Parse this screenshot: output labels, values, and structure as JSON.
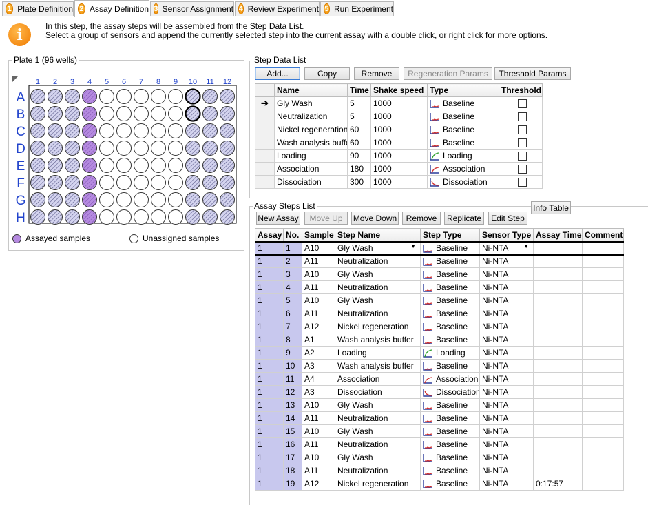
{
  "tabs": [
    {
      "num": "1",
      "label": "Plate Definition"
    },
    {
      "num": "2",
      "label": "Assay Definition"
    },
    {
      "num": "3",
      "label": "Sensor Assignment"
    },
    {
      "num": "4",
      "label": "Review Experiment"
    },
    {
      "num": "5",
      "label": "Run Experiment"
    }
  ],
  "info": {
    "icon": "i",
    "line1": "In this step, the assay steps will be assembled from the Step Data List.",
    "line2": "Select a group of sensors and append the currently selected step into the current assay with a double click, or right click for more options."
  },
  "plate": {
    "title": "Plate 1 (96 wells)",
    "cols": [
      "1",
      "2",
      "3",
      "4",
      "5",
      "6",
      "7",
      "8",
      "9",
      "10",
      "11",
      "12"
    ],
    "rows": [
      "A",
      "B",
      "C",
      "D",
      "E",
      "F",
      "G",
      "H"
    ],
    "legend_assayed": "Assayed samples",
    "legend_unassigned": "Unassigned samples",
    "colors": {
      "sensor": "#d4d4ef",
      "assayed": "#b58ae0",
      "empty": "#ffffff",
      "label": "#2244cc"
    },
    "well_types_note": "s=sensor hatched, a=assayed, e=empty, x=sensor selected",
    "wells": [
      [
        "s",
        "s",
        "s",
        "a",
        "e",
        "e",
        "e",
        "e",
        "e",
        "x",
        "s",
        "s"
      ],
      [
        "s",
        "s",
        "s",
        "a",
        "e",
        "e",
        "e",
        "e",
        "e",
        "x",
        "s",
        "s"
      ],
      [
        "s",
        "s",
        "s",
        "a",
        "e",
        "e",
        "e",
        "e",
        "e",
        "s",
        "s",
        "s"
      ],
      [
        "s",
        "s",
        "s",
        "a",
        "e",
        "e",
        "e",
        "e",
        "e",
        "s",
        "s",
        "s"
      ],
      [
        "s",
        "s",
        "s",
        "a",
        "e",
        "e",
        "e",
        "e",
        "e",
        "s",
        "s",
        "s"
      ],
      [
        "s",
        "s",
        "s",
        "a",
        "e",
        "e",
        "e",
        "e",
        "e",
        "s",
        "s",
        "s"
      ],
      [
        "s",
        "s",
        "s",
        "a",
        "e",
        "e",
        "e",
        "e",
        "e",
        "s",
        "s",
        "s"
      ],
      [
        "s",
        "s",
        "s",
        "a",
        "e",
        "e",
        "e",
        "e",
        "e",
        "s",
        "s",
        "s"
      ]
    ]
  },
  "step_data": {
    "title": "Step Data List",
    "buttons": {
      "add": "Add...",
      "copy": "Copy",
      "remove": "Remove",
      "regen": "Regeneration Params",
      "threshold": "Threshold Params"
    },
    "headers": {
      "name": "Name",
      "time": "Time",
      "shake": "Shake speed",
      "type": "Type",
      "threshold": "Threshold"
    },
    "rows": [
      {
        "name": "Gly Wash",
        "time": "5",
        "shake": "1000",
        "type": "Baseline"
      },
      {
        "name": "Neutralization",
        "time": "5",
        "shake": "1000",
        "type": "Baseline"
      },
      {
        "name": "Nickel regeneration",
        "time": "60",
        "shake": "1000",
        "type": "Baseline"
      },
      {
        "name": "Wash analysis buffer",
        "time": "60",
        "shake": "1000",
        "type": "Baseline"
      },
      {
        "name": "Loading",
        "time": "90",
        "shake": "1000",
        "type": "Loading"
      },
      {
        "name": "Association",
        "time": "180",
        "shake": "1000",
        "type": "Association"
      },
      {
        "name": "Dissociation",
        "time": "300",
        "shake": "1000",
        "type": "Dissociation"
      }
    ]
  },
  "assay_steps": {
    "title": "Assay Steps List",
    "info_table": "Info Table",
    "buttons": {
      "new_assay": "New Assay",
      "move_up": "Move Up",
      "move_down": "Move Down",
      "remove": "Remove",
      "replicate": "Replicate",
      "edit_step": "Edit Step"
    },
    "headers": {
      "assay": "Assay",
      "no": "No.",
      "sample": "Sample",
      "step_name": "Step Name",
      "step_type": "Step Type",
      "sensor_type": "Sensor Type",
      "assay_time": "Assay Time",
      "comment": "Comment"
    },
    "rows": [
      {
        "assay": "1",
        "no": "1",
        "sample": "A10",
        "step": "Gly Wash",
        "type": "Baseline",
        "sensor": "Ni-NTA",
        "time": ""
      },
      {
        "assay": "1",
        "no": "2",
        "sample": "A11",
        "step": "Neutralization",
        "type": "Baseline",
        "sensor": "Ni-NTA",
        "time": ""
      },
      {
        "assay": "1",
        "no": "3",
        "sample": "A10",
        "step": "Gly Wash",
        "type": "Baseline",
        "sensor": "Ni-NTA",
        "time": ""
      },
      {
        "assay": "1",
        "no": "4",
        "sample": "A11",
        "step": "Neutralization",
        "type": "Baseline",
        "sensor": "Ni-NTA",
        "time": ""
      },
      {
        "assay": "1",
        "no": "5",
        "sample": "A10",
        "step": "Gly Wash",
        "type": "Baseline",
        "sensor": "Ni-NTA",
        "time": ""
      },
      {
        "assay": "1",
        "no": "6",
        "sample": "A11",
        "step": "Neutralization",
        "type": "Baseline",
        "sensor": "Ni-NTA",
        "time": ""
      },
      {
        "assay": "1",
        "no": "7",
        "sample": "A12",
        "step": "Nickel regeneration",
        "type": "Baseline",
        "sensor": "Ni-NTA",
        "time": ""
      },
      {
        "assay": "1",
        "no": "8",
        "sample": "A1",
        "step": "Wash analysis buffer",
        "type": "Baseline",
        "sensor": "Ni-NTA",
        "time": ""
      },
      {
        "assay": "1",
        "no": "9",
        "sample": "A2",
        "step": "Loading",
        "type": "Loading",
        "sensor": "Ni-NTA",
        "time": ""
      },
      {
        "assay": "1",
        "no": "10",
        "sample": "A3",
        "step": "Wash analysis buffer",
        "type": "Baseline",
        "sensor": "Ni-NTA",
        "time": ""
      },
      {
        "assay": "1",
        "no": "11",
        "sample": "A4",
        "step": "Association",
        "type": "Association",
        "sensor": "Ni-NTA",
        "time": ""
      },
      {
        "assay": "1",
        "no": "12",
        "sample": "A3",
        "step": "Dissociation",
        "type": "Dissociation",
        "sensor": "Ni-NTA",
        "time": ""
      },
      {
        "assay": "1",
        "no": "13",
        "sample": "A10",
        "step": "Gly Wash",
        "type": "Baseline",
        "sensor": "Ni-NTA",
        "time": ""
      },
      {
        "assay": "1",
        "no": "14",
        "sample": "A11",
        "step": "Neutralization",
        "type": "Baseline",
        "sensor": "Ni-NTA",
        "time": ""
      },
      {
        "assay": "1",
        "no": "15",
        "sample": "A10",
        "step": "Gly Wash",
        "type": "Baseline",
        "sensor": "Ni-NTA",
        "time": ""
      },
      {
        "assay": "1",
        "no": "16",
        "sample": "A11",
        "step": "Neutralization",
        "type": "Baseline",
        "sensor": "Ni-NTA",
        "time": ""
      },
      {
        "assay": "1",
        "no": "17",
        "sample": "A10",
        "step": "Gly Wash",
        "type": "Baseline",
        "sensor": "Ni-NTA",
        "time": ""
      },
      {
        "assay": "1",
        "no": "18",
        "sample": "A11",
        "step": "Neutralization",
        "type": "Baseline",
        "sensor": "Ni-NTA",
        "time": ""
      },
      {
        "assay": "1",
        "no": "19",
        "sample": "A12",
        "step": "Nickel regeneration",
        "type": "Baseline",
        "sensor": "Ni-NTA",
        "time": "0:17:57"
      }
    ]
  }
}
